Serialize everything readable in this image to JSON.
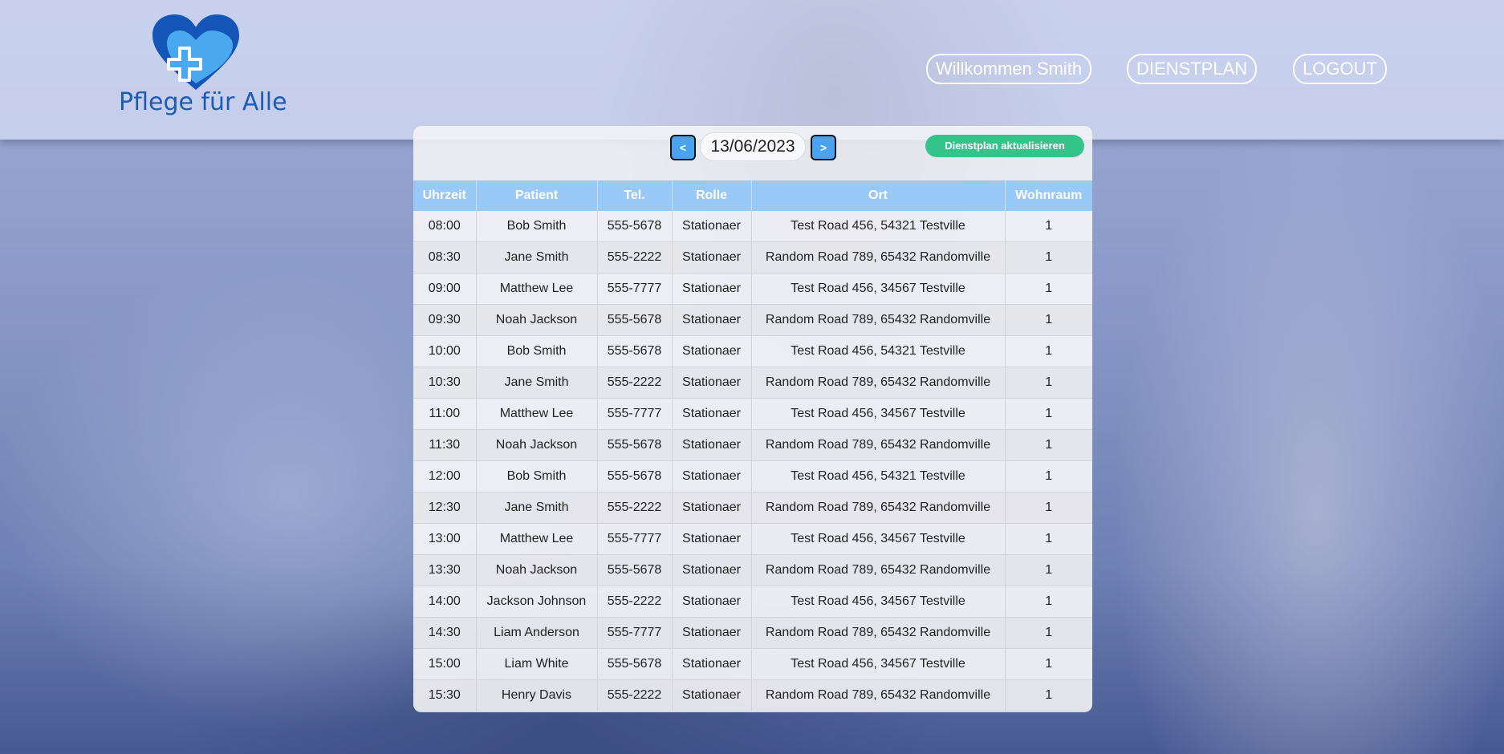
{
  "header": {
    "logo_text": "Pflege für Alle",
    "nav": {
      "welcome": "Willkommen Smith",
      "dienstplan": "DIENSTPLAN",
      "logout": "LOGOUT"
    }
  },
  "schedule": {
    "prev_label": "<",
    "next_label": ">",
    "date": "13/06/2023",
    "update_label": "Dienstplan aktualisieren",
    "columns": [
      "Uhrzeit",
      "Patient",
      "Tel.",
      "Rolle",
      "Ort",
      "Wohnraum"
    ],
    "rows": [
      [
        "08:00",
        "Bob Smith",
        "555-5678",
        "Stationaer",
        "Test Road 456, 54321 Testville",
        "1"
      ],
      [
        "08:30",
        "Jane Smith",
        "555-2222",
        "Stationaer",
        "Random Road 789, 65432 Randomville",
        "1"
      ],
      [
        "09:00",
        "Matthew Lee",
        "555-7777",
        "Stationaer",
        "Test Road 456, 34567 Testville",
        "1"
      ],
      [
        "09:30",
        "Noah Jackson",
        "555-5678",
        "Stationaer",
        "Random Road 789, 65432 Randomville",
        "1"
      ],
      [
        "10:00",
        "Bob Smith",
        "555-5678",
        "Stationaer",
        "Test Road 456, 54321 Testville",
        "1"
      ],
      [
        "10:30",
        "Jane Smith",
        "555-2222",
        "Stationaer",
        "Random Road 789, 65432 Randomville",
        "1"
      ],
      [
        "11:00",
        "Matthew Lee",
        "555-7777",
        "Stationaer",
        "Test Road 456, 34567 Testville",
        "1"
      ],
      [
        "11:30",
        "Noah Jackson",
        "555-5678",
        "Stationaer",
        "Random Road 789, 65432 Randomville",
        "1"
      ],
      [
        "12:00",
        "Bob Smith",
        "555-5678",
        "Stationaer",
        "Test Road 456, 54321 Testville",
        "1"
      ],
      [
        "12:30",
        "Jane Smith",
        "555-2222",
        "Stationaer",
        "Random Road 789, 65432 Randomville",
        "1"
      ],
      [
        "13:00",
        "Matthew Lee",
        "555-7777",
        "Stationaer",
        "Test Road 456, 34567 Testville",
        "1"
      ],
      [
        "13:30",
        "Noah Jackson",
        "555-5678",
        "Stationaer",
        "Random Road 789, 65432 Randomville",
        "1"
      ],
      [
        "14:00",
        "Jackson Johnson",
        "555-2222",
        "Stationaer",
        "Test Road 456, 34567 Testville",
        "1"
      ],
      [
        "14:30",
        "Liam Anderson",
        "555-7777",
        "Stationaer",
        "Random Road 789, 65432 Randomville",
        "1"
      ],
      [
        "15:00",
        "Liam White",
        "555-5678",
        "Stationaer",
        "Test Road 456, 34567 Testville",
        "1"
      ],
      [
        "15:30",
        "Henry Davis",
        "555-2222",
        "Stationaer",
        "Random Road 789, 65432 Randomville",
        "1"
      ]
    ]
  },
  "colors": {
    "brand_blue": "#1d5bb4",
    "heart_dark": "#1456b8",
    "heart_light": "#4aa8ee",
    "table_header": "#99c9f6",
    "update_button": "#33c48a",
    "arrow_button": "#4aa3f0"
  }
}
